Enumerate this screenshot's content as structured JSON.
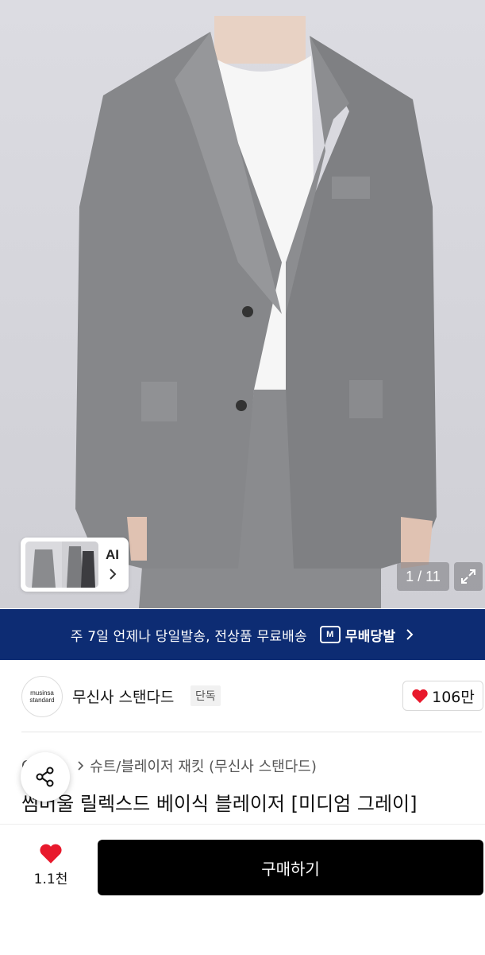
{
  "gallery": {
    "ai_label": "AI",
    "counter": "1 / 11"
  },
  "banner": {
    "text": "주 7일 언제나 당일발송, 전상품 무료배송",
    "service_name": "무배당발",
    "service_badge": "M"
  },
  "brand": {
    "logo_line1": "musinsa",
    "logo_line2": "standard",
    "name": "무신사 스탠다드",
    "tag": "단독",
    "like_count": "106만"
  },
  "product": {
    "breadcrumb_root": "O",
    "breadcrumb_category": "슈트/블레이저 재킷 (무신사 스탠다드)",
    "title": "썸머울 릴렉스드 베이식 블레이저 [미디엄 그레이]"
  },
  "bottom_bar": {
    "wish_count": "1.1천",
    "buy_label": "구매하기"
  },
  "colors": {
    "banner_bg": "#0d2c73",
    "heart": "#e8192c",
    "buy_bg": "#000000"
  }
}
